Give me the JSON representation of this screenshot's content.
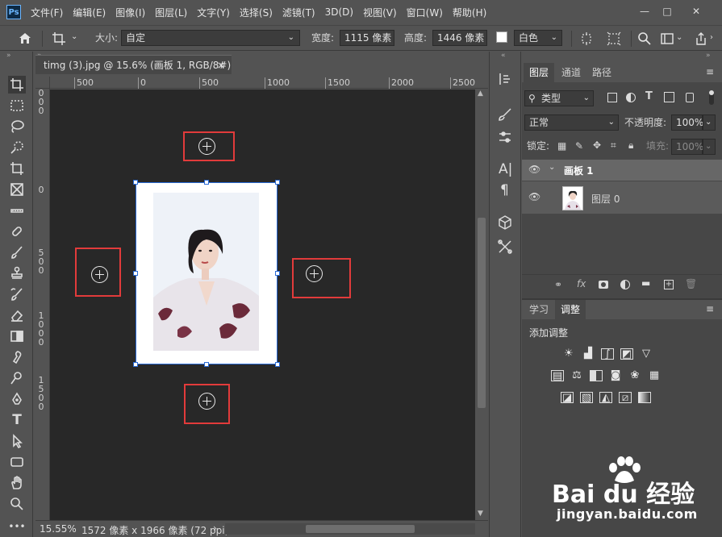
{
  "app": {
    "logo": "Ps"
  },
  "menu": [
    "文件(F)",
    "编辑(E)",
    "图像(I)",
    "图层(L)",
    "文字(Y)",
    "选择(S)",
    "滤镜(T)",
    "3D(D)",
    "视图(V)",
    "窗口(W)",
    "帮助(H)"
  ],
  "window_controls": {
    "minimize": "—",
    "maximize": "□",
    "close": "✕"
  },
  "options": {
    "size_label": "大小:",
    "size_value": "自定",
    "width_label": "宽度:",
    "width_value": "1115 像素",
    "height_label": "高度:",
    "height_value": "1446 像素",
    "color_value": "白色"
  },
  "document": {
    "tab_title": "timg (3).jpg @ 15.6% (画板 1, RGB/8#) *",
    "close": "×",
    "zoom": "15.55%",
    "info": "1572 像素 x 1966 像素 (72 ppi)",
    "info_arrow": "›"
  },
  "ruler_top": [
    "500",
    "0",
    "500",
    "1000",
    "1500",
    "2000",
    "2500"
  ],
  "ruler_left": [
    [
      "0",
      "0",
      "0"
    ],
    [
      "0"
    ],
    [
      "5",
      "0",
      "0"
    ],
    [
      "1",
      "0",
      "0",
      "0"
    ],
    [
      "1",
      "5",
      "0",
      "0"
    ]
  ],
  "layers_panel": {
    "tabs": [
      "图层",
      "通道",
      "路径"
    ],
    "filter_label": "类型",
    "blend_mode": "正常",
    "opacity_label": "不透明度:",
    "opacity_value": "100%",
    "lock_label": "锁定:",
    "fill_label": "填充:",
    "fill_value": "100%",
    "artboard_name": "画板 1",
    "layer_name": "图层 0"
  },
  "adjust_panel": {
    "tabs": [
      "学习",
      "调整"
    ],
    "title": "添加调整"
  },
  "watermark": {
    "brand": "Bai du 经验",
    "url": "jingyan.baidu.com"
  },
  "colors": {
    "accent_red": "#e23b3b",
    "panel": "#535353",
    "canvas_bg": "#282828",
    "selection_blue": "#2a6bd6"
  }
}
